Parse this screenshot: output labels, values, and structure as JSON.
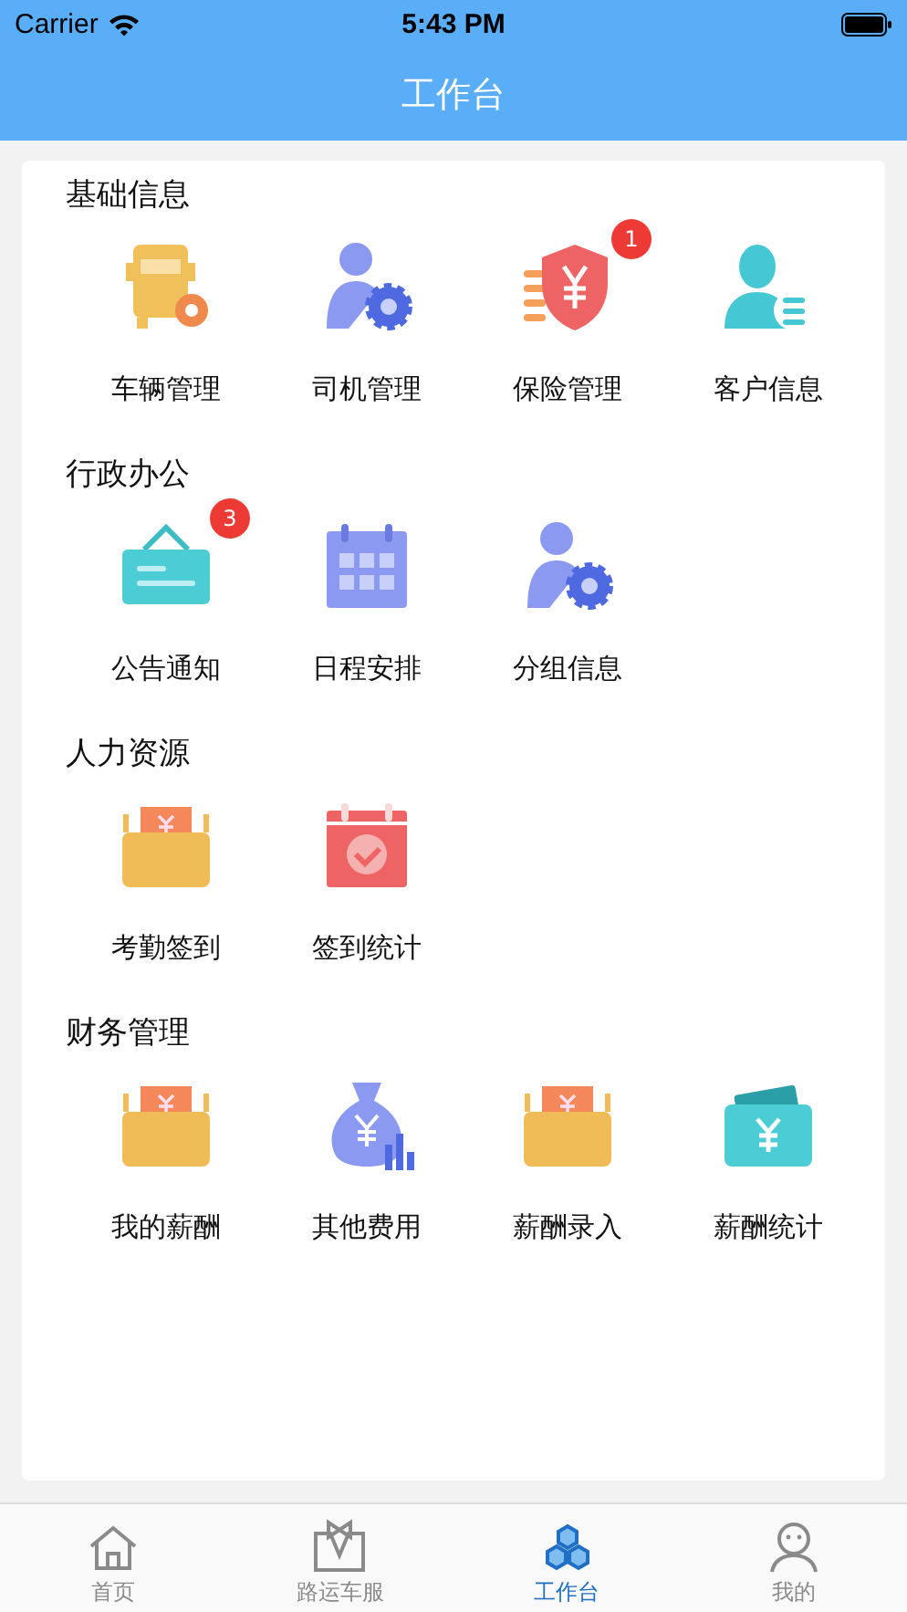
{
  "status_bar": {
    "carrier": "Carrier",
    "time": "5:43 PM"
  },
  "nav": {
    "title": "工作台"
  },
  "sections": [
    {
      "title": "基础信息",
      "items": [
        {
          "label": "车辆管理",
          "kind": "truck"
        },
        {
          "label": "司机管理",
          "kind": "person-gear"
        },
        {
          "label": "保险管理",
          "kind": "shield",
          "badge": "1"
        },
        {
          "label": "客户信息",
          "kind": "contact"
        }
      ]
    },
    {
      "title": "行政办公",
      "items": [
        {
          "label": "公告通知",
          "kind": "sign",
          "badge": "3"
        },
        {
          "label": "日程安排",
          "kind": "calendar"
        },
        {
          "label": "分组信息",
          "kind": "person-gear"
        }
      ]
    },
    {
      "title": "人力资源",
      "items": [
        {
          "label": "考勤签到",
          "kind": "wallet"
        },
        {
          "label": "签到统计",
          "kind": "calendar-check"
        }
      ]
    },
    {
      "title": "财务管理",
      "items": [
        {
          "label": "我的薪酬",
          "kind": "wallet"
        },
        {
          "label": "其他费用",
          "kind": "money-bag"
        },
        {
          "label": "薪酬录入",
          "kind": "wallet"
        },
        {
          "label": "薪酬统计",
          "kind": "card-wallet"
        }
      ]
    }
  ],
  "tabs": [
    {
      "label": "首页",
      "kind": "home",
      "selected": false
    },
    {
      "label": "路运车服",
      "kind": "suit",
      "selected": false
    },
    {
      "label": "工作台",
      "kind": "hexes",
      "selected": true
    },
    {
      "label": "我的",
      "kind": "person",
      "selected": false
    }
  ]
}
